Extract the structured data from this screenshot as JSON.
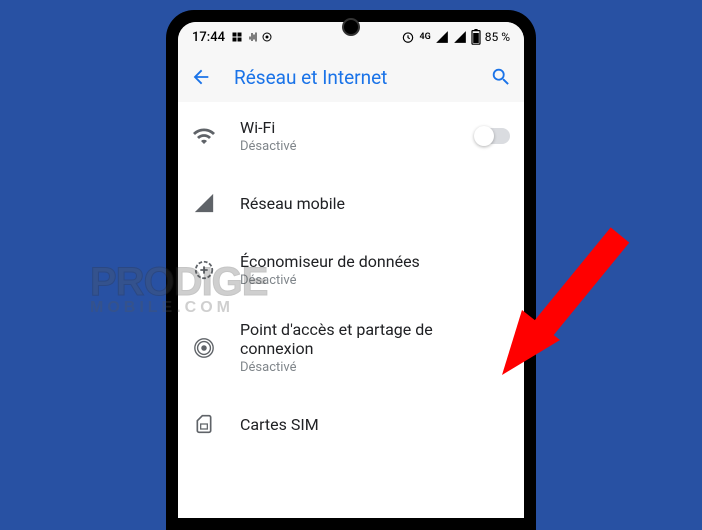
{
  "status_bar": {
    "time": "17:44",
    "network_label": "4G",
    "battery_text": "85 %"
  },
  "app_bar": {
    "title": "Réseau et Internet"
  },
  "items": {
    "wifi": {
      "title": "Wi-Fi",
      "sub": "Désactivé"
    },
    "mobile": {
      "title": "Réseau mobile"
    },
    "data_saver": {
      "title": "Économiseur de données",
      "sub": "Désactivé"
    },
    "hotspot": {
      "title": "Point d'accès et partage de connexion",
      "sub": "Désactivé"
    },
    "sim": {
      "title": "Cartes SIM"
    }
  },
  "watermark": {
    "main": "PRODIGE",
    "sub": "MOBILE.COM"
  }
}
